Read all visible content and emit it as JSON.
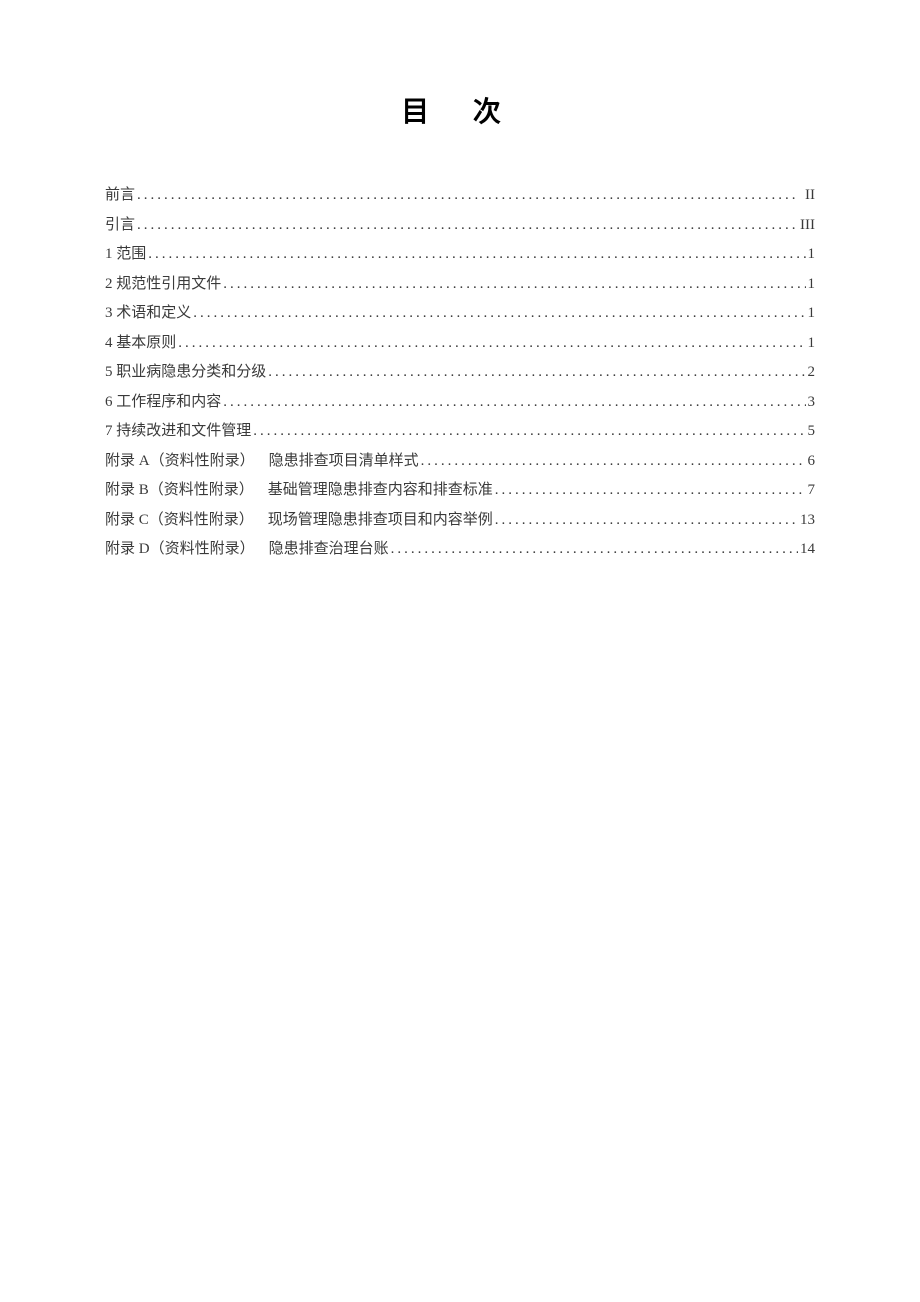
{
  "title": "目 次",
  "entries": [
    {
      "label": "前言",
      "desc": "",
      "page": "II"
    },
    {
      "label": "引言",
      "desc": "",
      "page": "III"
    },
    {
      "label": "1  范围",
      "desc": "",
      "page": "1"
    },
    {
      "label": "2  规范性引用文件",
      "desc": "",
      "page": "1"
    },
    {
      "label": "3  术语和定义",
      "desc": "",
      "page": "1"
    },
    {
      "label": "4  基本原则",
      "desc": "",
      "page": "1"
    },
    {
      "label": "5  职业病隐患分类和分级",
      "desc": "",
      "page": "2"
    },
    {
      "label": "6  工作程序和内容",
      "desc": "",
      "page": "3"
    },
    {
      "label": "7  持续改进和文件管理",
      "desc": "",
      "page": "5"
    },
    {
      "label": "附录 A（资料性附录）",
      "desc": "隐患排查项目清单样式",
      "page": "6"
    },
    {
      "label": "附录 B（资料性附录）",
      "desc": "基础管理隐患排查内容和排查标准",
      "page": "7"
    },
    {
      "label": "附录 C（资料性附录）",
      "desc": "现场管理隐患排查项目和内容举例",
      "page": "13"
    },
    {
      "label": "附录 D（资料性附录）",
      "desc": "隐患排查治理台账",
      "page": "14"
    }
  ]
}
